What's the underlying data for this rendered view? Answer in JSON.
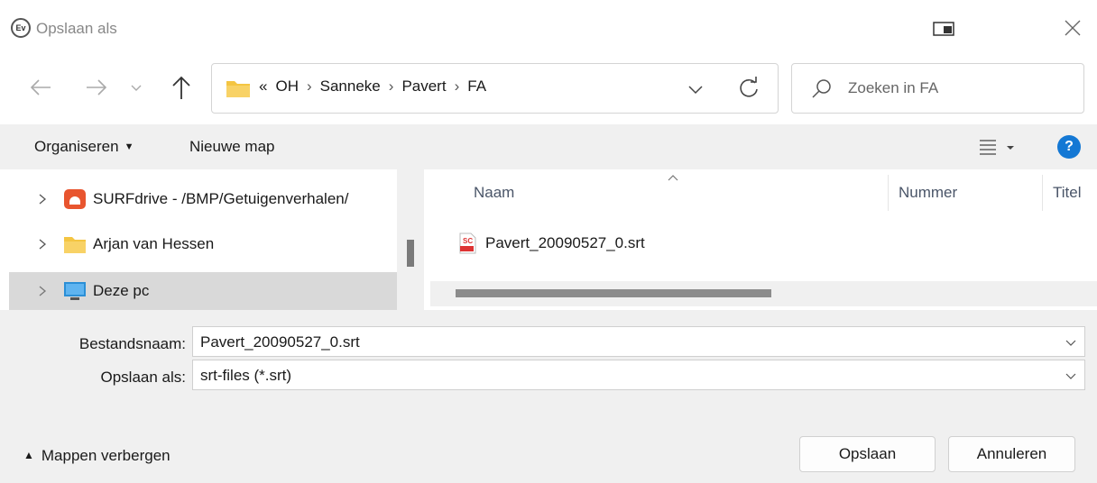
{
  "window": {
    "title": "Opslaan als"
  },
  "nav": {
    "breadcrumb_prefix": "«",
    "breadcrumb": [
      "OH",
      "Sanneke",
      "Pavert",
      "FA"
    ],
    "separator": "›"
  },
  "search": {
    "placeholder": "Zoeken in FA"
  },
  "toolbar": {
    "organize_label": "Organiseren",
    "new_folder_label": "Nieuwe map",
    "help_label": "?"
  },
  "navpane": {
    "items": [
      {
        "label": "SURFdrive - /BMP/Getuigenverhalen/",
        "icon": "surfdrive-icon"
      },
      {
        "label": "Arjan van Hessen",
        "icon": "folder-icon"
      },
      {
        "label": "Deze pc",
        "icon": "monitor-icon",
        "selected": true
      }
    ]
  },
  "filelist": {
    "columns": [
      "Naam",
      "Nummer",
      "Titel"
    ],
    "files": [
      {
        "name": "Pavert_20090527_0.srt",
        "icon": "srt-file-icon"
      }
    ]
  },
  "form": {
    "filename_label": "Bestandsnaam:",
    "filename_value": "Pavert_20090527_0.srt",
    "type_label": "Opslaan als:",
    "type_value": "srt-files (*.srt)"
  },
  "footer": {
    "toggle_label": "Mappen verbergen",
    "save_label": "Opslaan",
    "cancel_label": "Annuleren"
  },
  "colors": {
    "accent": "#1478d4",
    "folder": "#f4c542",
    "surfdrive": "#e8552f",
    "panel": "#f0f0f0",
    "selected": "#d9d9d9"
  }
}
